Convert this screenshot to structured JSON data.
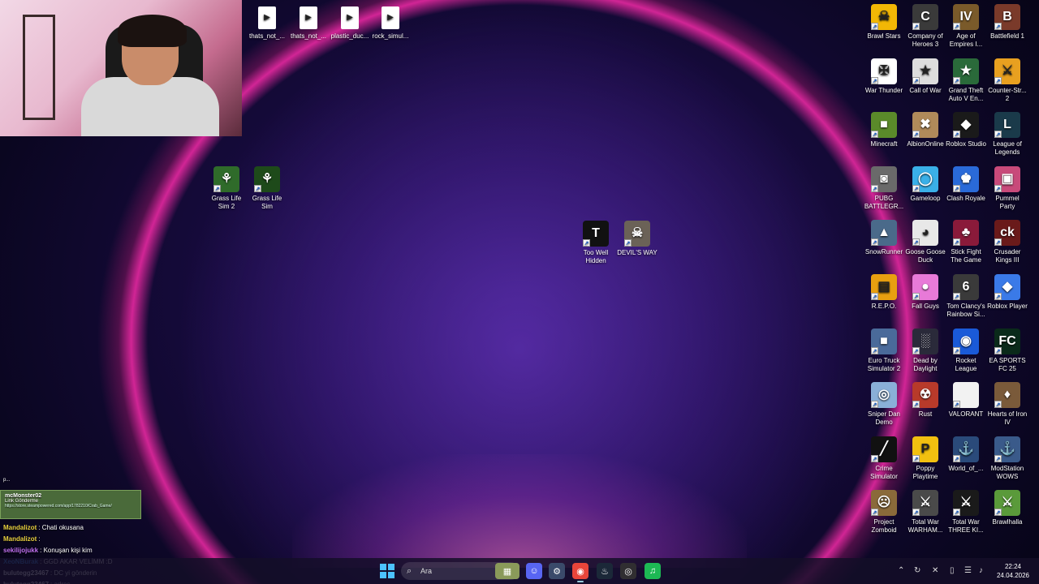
{
  "desktop_top_files": [
    {
      "label": "thats_not_...",
      "icon": "media-file-icon"
    },
    {
      "label": "thats_not_...",
      "icon": "media-file-icon"
    },
    {
      "label": "plastic_duc...",
      "icon": "media-file-icon"
    },
    {
      "label": "rock_simul...",
      "icon": "media-file-icon"
    }
  ],
  "desktop_mid_icons": [
    {
      "label": "Grass Life Sim 2",
      "color": "#2f6b2a",
      "glyph": "⚘"
    },
    {
      "label": "Grass Life Sim",
      "color": "#1e4a1a",
      "glyph": "⚘"
    },
    {
      "label": "Too Well Hidden",
      "color": "#111111",
      "glyph": "T"
    },
    {
      "label": "DEVIL'S WAY",
      "color": "#6b6257",
      "glyph": "☠"
    }
  ],
  "desktop_right_icons": [
    {
      "label": "Brawl Stars",
      "color": "#f2b705",
      "glyph": "☠"
    },
    {
      "label": "Company of Heroes 3",
      "color": "#3a3a3a",
      "glyph": "C"
    },
    {
      "label": "Age of Empires I...",
      "color": "#7a5a2a",
      "glyph": "IV"
    },
    {
      "label": "Battlefield 1",
      "color": "#7a3a2a",
      "glyph": "B"
    },
    {
      "label": "War Thunder",
      "color": "#ffffff",
      "glyph": "✠"
    },
    {
      "label": "Call of War",
      "color": "#dddddd",
      "glyph": "★"
    },
    {
      "label": "Grand Theft Auto V En...",
      "color": "#2a6a3a",
      "glyph": "★"
    },
    {
      "label": "Counter-Str... 2",
      "color": "#e8a020",
      "glyph": "⚔"
    },
    {
      "label": "Minecraft",
      "color": "#5a8a2a",
      "glyph": "■"
    },
    {
      "label": "AlbionOnline",
      "color": "#b08a5a",
      "glyph": "✖"
    },
    {
      "label": "Roblox Studio",
      "color": "#1a1a1a",
      "glyph": "◆"
    },
    {
      "label": "League of Legends",
      "color": "#1a3a4a",
      "glyph": "L"
    },
    {
      "label": "PUBG BATTLEGR...",
      "color": "#6a6a6a",
      "glyph": "◙"
    },
    {
      "label": "Gameloop",
      "color": "#3ab0e8",
      "glyph": "◯"
    },
    {
      "label": "Clash Royale",
      "color": "#2a6ad8",
      "glyph": "♚"
    },
    {
      "label": "Pummel Party",
      "color": "#c84a7a",
      "glyph": "▣"
    },
    {
      "label": "SnowRunner",
      "color": "#4a6a8a",
      "glyph": "▲"
    },
    {
      "label": "Goose Goose Duck",
      "color": "#e8e8e8",
      "glyph": "◕"
    },
    {
      "label": "Stick Fight The Game",
      "color": "#8a1a3a",
      "glyph": "♣"
    },
    {
      "label": "Crusader Kings III",
      "color": "#6a1a1a",
      "glyph": "ck"
    },
    {
      "label": "R.E.P.O.",
      "color": "#e8a010",
      "glyph": "▤"
    },
    {
      "label": "Fall Guys",
      "color": "#e87ad8",
      "glyph": "●"
    },
    {
      "label": "Tom Clancy's Rainbow Si...",
      "color": "#3a3a3a",
      "glyph": "6"
    },
    {
      "label": "Roblox Player",
      "color": "#3a7ae8",
      "glyph": "◆"
    },
    {
      "label": "Euro Truck Simulator 2",
      "color": "#4a6a9a",
      "glyph": "■"
    },
    {
      "label": "Dead by Daylight",
      "color": "#2a2a3a",
      "glyph": "░"
    },
    {
      "label": "Rocket League",
      "color": "#1a5ad8",
      "glyph": "◉"
    },
    {
      "label": "EA SPORTS FC 25",
      "color": "#0a2a1a",
      "glyph": "FC"
    },
    {
      "label": "Sniper Dan Demo",
      "color": "#8ab0d8",
      "glyph": "◎"
    },
    {
      "label": "Rust",
      "color": "#b83a2a",
      "glyph": "☢"
    },
    {
      "label": "VALORANT",
      "color": "#f2f2f2",
      "glyph": ""
    },
    {
      "label": "Hearts of Iron IV",
      "color": "#7a5a3a",
      "glyph": "♦"
    },
    {
      "label": "Crime Simulator",
      "color": "#111111",
      "glyph": "╱"
    },
    {
      "label": "Poppy Playtime",
      "color": "#f2c010",
      "glyph": "P"
    },
    {
      "label": "World_of_...",
      "color": "#2a4a7a",
      "glyph": "⚓"
    },
    {
      "label": "ModStation WOWS",
      "color": "#3a5a8a",
      "glyph": "⚓"
    },
    {
      "label": "Project Zomboid",
      "color": "#8a6a3a",
      "glyph": "☹"
    },
    {
      "label": "Total War WARHAM...",
      "color": "#4a4a4a",
      "glyph": "⚔"
    },
    {
      "label": "Total War THREE KI...",
      "color": "#1a1a1a",
      "glyph": "⚔"
    },
    {
      "label": "Brawlhalla",
      "color": "#5a9a3a",
      "glyph": "⚔"
    }
  ],
  "chat": {
    "top_marker": "p...",
    "highlight_user": "mcMonster02",
    "highlight_tag": "Link Gönderme",
    "highlight_link": "https://store.steampowered.com/app/1782210/Crab_Game/",
    "messages": [
      {
        "user": "Mandalizot",
        "text": ": Chati okusana",
        "color": "#e8d040"
      },
      {
        "user": "Mandalizot",
        "text": ":",
        "color": "#e8d040"
      },
      {
        "user": "sekilijojukk",
        "text": ": Konuşan kişi kim",
        "color": "#c070f0"
      },
      {
        "user": "XeoNBurak",
        "text": ": GGD AKAR VELİMM :D",
        "color": "#3a8ae8"
      },
      {
        "user": "bulutegg23467",
        "text": ": DC yi gönderin",
        "color": "#ffffff"
      },
      {
        "user": "bulutegg23467",
        "text": ": adres",
        "color": "#ffffff"
      }
    ]
  },
  "taskbar": {
    "search_placeholder": "Ara",
    "clock_time": "22:24",
    "clock_date": "24.04.2026",
    "apps": [
      {
        "name": "game-app-icon",
        "glyph": "▦",
        "color": "#8a9a5a"
      },
      {
        "name": "discord-icon",
        "glyph": "☺",
        "color": "#5865f2"
      },
      {
        "name": "settings-app-icon",
        "glyph": "⚙",
        "color": "#3a4a6a"
      },
      {
        "name": "chrome-icon",
        "glyph": "◉",
        "color": "#e8453a"
      },
      {
        "name": "steam-icon",
        "glyph": "♨",
        "color": "#1b2838"
      },
      {
        "name": "obs-icon",
        "glyph": "◎",
        "color": "#302e31"
      },
      {
        "name": "spotify-icon",
        "glyph": "♫",
        "color": "#1db954"
      }
    ]
  }
}
